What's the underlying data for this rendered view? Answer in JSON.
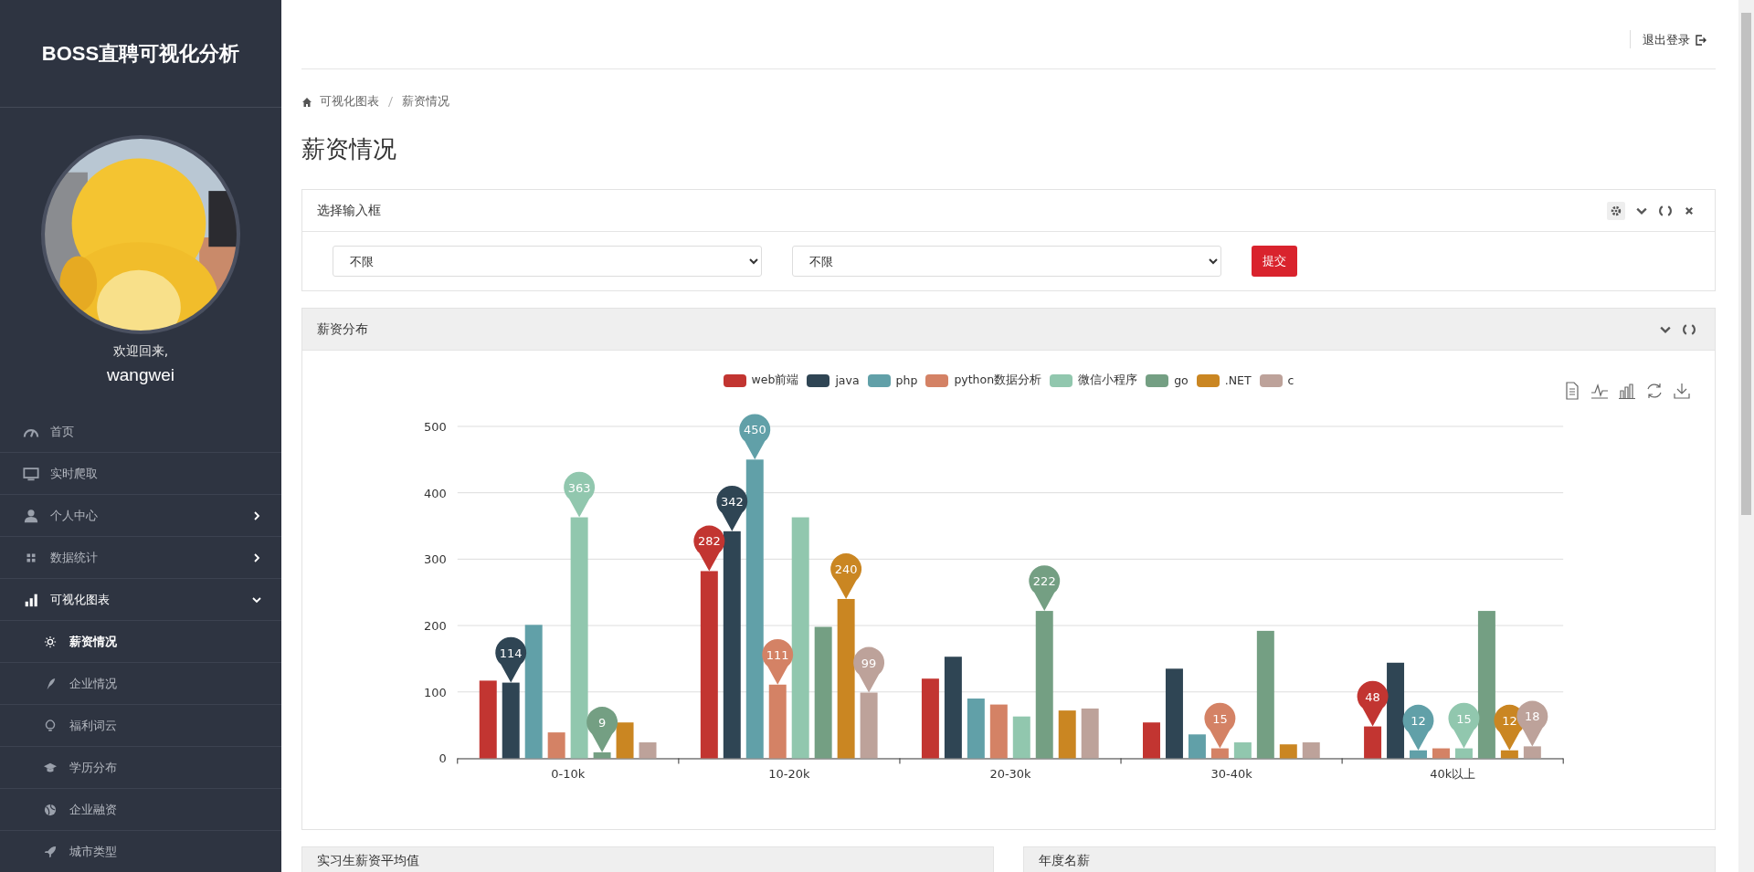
{
  "sidebar": {
    "title": "BOSS直聘可视化分析",
    "welcome": "欢迎回来,",
    "username": "wangwei",
    "menu": [
      {
        "label": "首页"
      },
      {
        "label": "实时爬取"
      },
      {
        "label": "个人中心",
        "expanded": false
      },
      {
        "label": "数据统计",
        "expanded": false
      },
      {
        "label": "可视化图表",
        "expanded": true,
        "children": [
          {
            "label": "薪资情况",
            "selected": true
          },
          {
            "label": "企业情况",
            "selected": false
          },
          {
            "label": "福利词云",
            "selected": false
          },
          {
            "label": "学历分布",
            "selected": false
          },
          {
            "label": "企业融资",
            "selected": false
          },
          {
            "label": "城市类型",
            "selected": false
          }
        ]
      }
    ]
  },
  "topbar": {
    "logout": "退出登录"
  },
  "breadcrumb": [
    "可视化图表",
    "薪资情况"
  ],
  "page_title": "薪资情况",
  "filter_panel": {
    "title": "选择输入框",
    "selects": [
      {
        "value": "不限"
      },
      {
        "value": "不限"
      }
    ],
    "submit": "提交"
  },
  "chart_panel": {
    "title": "薪资分布",
    "chart_data": {
      "type": "bar",
      "categories": [
        "0-10k",
        "10-20k",
        "20-30k",
        "30-40k",
        "40k以上"
      ],
      "ylim": [
        0,
        500
      ],
      "yticks": [
        0,
        100,
        200,
        300,
        400,
        500
      ],
      "series": [
        {
          "name": "web前端",
          "color": "#c23531",
          "values": [
            117,
            282,
            120,
            54,
            48
          ]
        },
        {
          "name": "java",
          "color": "#2f4554",
          "values": [
            114,
            342,
            153,
            135,
            144
          ]
        },
        {
          "name": "php",
          "color": "#61a0a8",
          "values": [
            201,
            450,
            90,
            36,
            12
          ]
        },
        {
          "name": "python数据分析",
          "color": "#d48265",
          "values": [
            39,
            111,
            81,
            15,
            15
          ]
        },
        {
          "name": "微信小程序",
          "color": "#91c7ae",
          "values": [
            363,
            363,
            63,
            24,
            15
          ]
        },
        {
          "name": "go",
          "color": "#749f83",
          "values": [
            9,
            198,
            222,
            192,
            222
          ]
        },
        {
          "name": ".NET",
          "color": "#ca8622",
          "values": [
            54,
            240,
            72,
            21,
            12
          ]
        },
        {
          "name": "c",
          "color": "#bda29a",
          "values": [
            24,
            99,
            75,
            24,
            18
          ]
        }
      ],
      "grid": true,
      "legend": true,
      "annotations": [
        "282",
        "48",
        "342",
        "114",
        "450",
        "12",
        "111",
        "15",
        "363",
        "15",
        "222",
        "9",
        "240",
        "12",
        "99",
        "18"
      ]
    }
  },
  "bottom_panels": [
    {
      "title": "实习生薪资平均值"
    },
    {
      "title": "年度名薪"
    }
  ]
}
